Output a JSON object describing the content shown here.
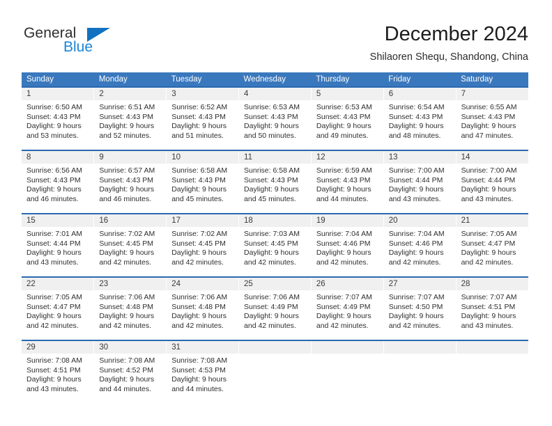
{
  "brand": {
    "name_top": "General",
    "name_bottom": "Blue",
    "triangle_color": "#1271c0",
    "blue_color": "#1b85d6"
  },
  "header": {
    "title": "December 2024",
    "subtitle": "Shilaoren Shequ, Shandong, China"
  },
  "theme": {
    "header_bg": "#3a78bd",
    "row_rule": "#2a69b0",
    "daynum_bg": "#f0f0f0"
  },
  "weekday_headers": [
    "Sunday",
    "Monday",
    "Tuesday",
    "Wednesday",
    "Thursday",
    "Friday",
    "Saturday"
  ],
  "weeks": [
    {
      "days": [
        {
          "day": "1",
          "sunrise": "Sunrise: 6:50 AM",
          "sunset": "Sunset: 4:43 PM",
          "daylight_line1": "Daylight: 9 hours",
          "daylight_line2": "and 53 minutes."
        },
        {
          "day": "2",
          "sunrise": "Sunrise: 6:51 AM",
          "sunset": "Sunset: 4:43 PM",
          "daylight_line1": "Daylight: 9 hours",
          "daylight_line2": "and 52 minutes."
        },
        {
          "day": "3",
          "sunrise": "Sunrise: 6:52 AM",
          "sunset": "Sunset: 4:43 PM",
          "daylight_line1": "Daylight: 9 hours",
          "daylight_line2": "and 51 minutes."
        },
        {
          "day": "4",
          "sunrise": "Sunrise: 6:53 AM",
          "sunset": "Sunset: 4:43 PM",
          "daylight_line1": "Daylight: 9 hours",
          "daylight_line2": "and 50 minutes."
        },
        {
          "day": "5",
          "sunrise": "Sunrise: 6:53 AM",
          "sunset": "Sunset: 4:43 PM",
          "daylight_line1": "Daylight: 9 hours",
          "daylight_line2": "and 49 minutes."
        },
        {
          "day": "6",
          "sunrise": "Sunrise: 6:54 AM",
          "sunset": "Sunset: 4:43 PM",
          "daylight_line1": "Daylight: 9 hours",
          "daylight_line2": "and 48 minutes."
        },
        {
          "day": "7",
          "sunrise": "Sunrise: 6:55 AM",
          "sunset": "Sunset: 4:43 PM",
          "daylight_line1": "Daylight: 9 hours",
          "daylight_line2": "and 47 minutes."
        }
      ]
    },
    {
      "days": [
        {
          "day": "8",
          "sunrise": "Sunrise: 6:56 AM",
          "sunset": "Sunset: 4:43 PM",
          "daylight_line1": "Daylight: 9 hours",
          "daylight_line2": "and 46 minutes."
        },
        {
          "day": "9",
          "sunrise": "Sunrise: 6:57 AM",
          "sunset": "Sunset: 4:43 PM",
          "daylight_line1": "Daylight: 9 hours",
          "daylight_line2": "and 46 minutes."
        },
        {
          "day": "10",
          "sunrise": "Sunrise: 6:58 AM",
          "sunset": "Sunset: 4:43 PM",
          "daylight_line1": "Daylight: 9 hours",
          "daylight_line2": "and 45 minutes."
        },
        {
          "day": "11",
          "sunrise": "Sunrise: 6:58 AM",
          "sunset": "Sunset: 4:43 PM",
          "daylight_line1": "Daylight: 9 hours",
          "daylight_line2": "and 45 minutes."
        },
        {
          "day": "12",
          "sunrise": "Sunrise: 6:59 AM",
          "sunset": "Sunset: 4:43 PM",
          "daylight_line1": "Daylight: 9 hours",
          "daylight_line2": "and 44 minutes."
        },
        {
          "day": "13",
          "sunrise": "Sunrise: 7:00 AM",
          "sunset": "Sunset: 4:44 PM",
          "daylight_line1": "Daylight: 9 hours",
          "daylight_line2": "and 43 minutes."
        },
        {
          "day": "14",
          "sunrise": "Sunrise: 7:00 AM",
          "sunset": "Sunset: 4:44 PM",
          "daylight_line1": "Daylight: 9 hours",
          "daylight_line2": "and 43 minutes."
        }
      ]
    },
    {
      "days": [
        {
          "day": "15",
          "sunrise": "Sunrise: 7:01 AM",
          "sunset": "Sunset: 4:44 PM",
          "daylight_line1": "Daylight: 9 hours",
          "daylight_line2": "and 43 minutes."
        },
        {
          "day": "16",
          "sunrise": "Sunrise: 7:02 AM",
          "sunset": "Sunset: 4:45 PM",
          "daylight_line1": "Daylight: 9 hours",
          "daylight_line2": "and 42 minutes."
        },
        {
          "day": "17",
          "sunrise": "Sunrise: 7:02 AM",
          "sunset": "Sunset: 4:45 PM",
          "daylight_line1": "Daylight: 9 hours",
          "daylight_line2": "and 42 minutes."
        },
        {
          "day": "18",
          "sunrise": "Sunrise: 7:03 AM",
          "sunset": "Sunset: 4:45 PM",
          "daylight_line1": "Daylight: 9 hours",
          "daylight_line2": "and 42 minutes."
        },
        {
          "day": "19",
          "sunrise": "Sunrise: 7:04 AM",
          "sunset": "Sunset: 4:46 PM",
          "daylight_line1": "Daylight: 9 hours",
          "daylight_line2": "and 42 minutes."
        },
        {
          "day": "20",
          "sunrise": "Sunrise: 7:04 AM",
          "sunset": "Sunset: 4:46 PM",
          "daylight_line1": "Daylight: 9 hours",
          "daylight_line2": "and 42 minutes."
        },
        {
          "day": "21",
          "sunrise": "Sunrise: 7:05 AM",
          "sunset": "Sunset: 4:47 PM",
          "daylight_line1": "Daylight: 9 hours",
          "daylight_line2": "and 42 minutes."
        }
      ]
    },
    {
      "days": [
        {
          "day": "22",
          "sunrise": "Sunrise: 7:05 AM",
          "sunset": "Sunset: 4:47 PM",
          "daylight_line1": "Daylight: 9 hours",
          "daylight_line2": "and 42 minutes."
        },
        {
          "day": "23",
          "sunrise": "Sunrise: 7:06 AM",
          "sunset": "Sunset: 4:48 PM",
          "daylight_line1": "Daylight: 9 hours",
          "daylight_line2": "and 42 minutes."
        },
        {
          "day": "24",
          "sunrise": "Sunrise: 7:06 AM",
          "sunset": "Sunset: 4:48 PM",
          "daylight_line1": "Daylight: 9 hours",
          "daylight_line2": "and 42 minutes."
        },
        {
          "day": "25",
          "sunrise": "Sunrise: 7:06 AM",
          "sunset": "Sunset: 4:49 PM",
          "daylight_line1": "Daylight: 9 hours",
          "daylight_line2": "and 42 minutes."
        },
        {
          "day": "26",
          "sunrise": "Sunrise: 7:07 AM",
          "sunset": "Sunset: 4:49 PM",
          "daylight_line1": "Daylight: 9 hours",
          "daylight_line2": "and 42 minutes."
        },
        {
          "day": "27",
          "sunrise": "Sunrise: 7:07 AM",
          "sunset": "Sunset: 4:50 PM",
          "daylight_line1": "Daylight: 9 hours",
          "daylight_line2": "and 42 minutes."
        },
        {
          "day": "28",
          "sunrise": "Sunrise: 7:07 AM",
          "sunset": "Sunset: 4:51 PM",
          "daylight_line1": "Daylight: 9 hours",
          "daylight_line2": "and 43 minutes."
        }
      ]
    },
    {
      "days": [
        {
          "day": "29",
          "sunrise": "Sunrise: 7:08 AM",
          "sunset": "Sunset: 4:51 PM",
          "daylight_line1": "Daylight: 9 hours",
          "daylight_line2": "and 43 minutes."
        },
        {
          "day": "30",
          "sunrise": "Sunrise: 7:08 AM",
          "sunset": "Sunset: 4:52 PM",
          "daylight_line1": "Daylight: 9 hours",
          "daylight_line2": "and 44 minutes."
        },
        {
          "day": "31",
          "sunrise": "Sunrise: 7:08 AM",
          "sunset": "Sunset: 4:53 PM",
          "daylight_line1": "Daylight: 9 hours",
          "daylight_line2": "and 44 minutes."
        },
        {
          "day": "",
          "sunrise": "",
          "sunset": "",
          "daylight_line1": "",
          "daylight_line2": ""
        },
        {
          "day": "",
          "sunrise": "",
          "sunset": "",
          "daylight_line1": "",
          "daylight_line2": ""
        },
        {
          "day": "",
          "sunrise": "",
          "sunset": "",
          "daylight_line1": "",
          "daylight_line2": ""
        },
        {
          "day": "",
          "sunrise": "",
          "sunset": "",
          "daylight_line1": "",
          "daylight_line2": ""
        }
      ]
    }
  ]
}
